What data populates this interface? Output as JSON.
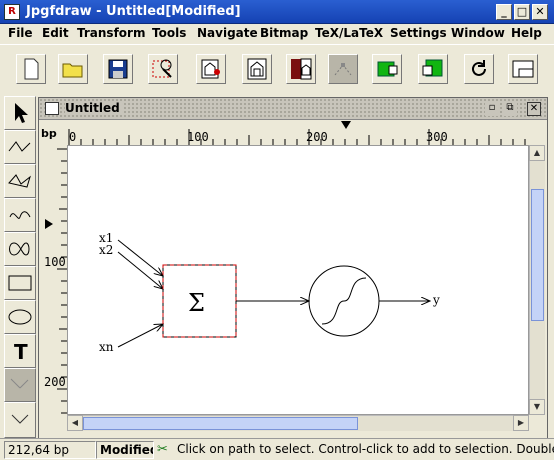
{
  "window": {
    "title": "Jpgfdraw - Untitled[Modified]",
    "app_icon_letter": "R"
  },
  "menubar": {
    "items": [
      "File",
      "Edit",
      "Transform",
      "Tools",
      "Navigate",
      "Bitmap",
      "TeX/LaTeX",
      "Settings",
      "Window",
      "Help"
    ]
  },
  "toolbar": {
    "buttons": [
      "new-icon",
      "open-folder-icon",
      "save-disk-icon",
      "select-rectangle-icon",
      "image-icon",
      "image-dark-icon",
      "image-red-icon",
      "edit-path-icon",
      "green-object-icon",
      "green-object-arrow-icon",
      "rotate-icon",
      "minimize-frame-icon"
    ]
  },
  "palette": {
    "tools": [
      "select-arrow-icon",
      "open-line-icon",
      "closed-line-icon",
      "curve-icon",
      "closed-curve-icon",
      "rectangle-icon",
      "ellipse-icon",
      "text-tool-icon",
      "math-text-icon",
      "chevron-down-icon"
    ],
    "text_tool_label": "T"
  },
  "document": {
    "title": "Untitled",
    "ruler_unit": "bp",
    "hruler_labels": [
      "0",
      "100",
      "200",
      "300"
    ],
    "vruler_labels": [
      "100",
      "200"
    ],
    "diagram": {
      "inputs": [
        "x1",
        "x2",
        "xn"
      ],
      "sum_symbol": "Σ",
      "output": "y"
    }
  },
  "statusbar": {
    "coords": "212,64 bp",
    "modified": "Modified",
    "message": "Click on path to select. Control-click to add to selection. Double"
  },
  "colors": {
    "titlebar": "#2a5fd1",
    "selection_box": "#cc0000",
    "chrome": "#ece9d8"
  }
}
